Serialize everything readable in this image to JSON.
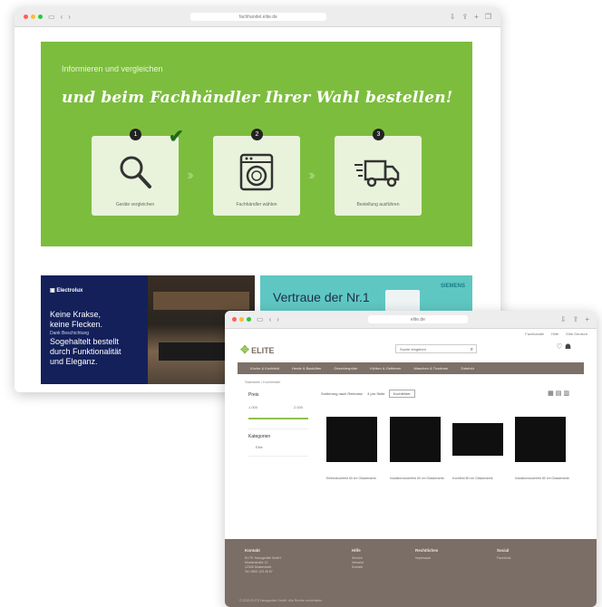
{
  "window1": {
    "url": "fachhandel.elite.de",
    "hero": {
      "subtitle": "Informieren und vergleichen",
      "title": "und beim Fachhändler Ihrer Wahl bestellen!",
      "steps": [
        {
          "number": "1",
          "label": "Geräte vergleichen",
          "icon": "magnifier-icon"
        },
        {
          "number": "2",
          "label": "Fachhändler wählen",
          "icon": "washing-machine-icon"
        },
        {
          "number": "3",
          "label": "Bestellung ausführen",
          "icon": "delivery-truck-icon"
        }
      ]
    },
    "banner_electrolux": {
      "brand": "Electrolux",
      "headline_1": "Keine Krakse,",
      "headline_2": "keine Flecken.",
      "small": "Dank Beschichtung",
      "headline_3": "Sogehaltelt bestellt",
      "headline_4": "durch Funktionalität",
      "headline_5": "und Eleganz."
    },
    "banner_siemens": {
      "headline": "Vertraue der Nr.1",
      "brand": "SIEMENS"
    }
  },
  "window2": {
    "url": "elite.de",
    "top_links": [
      "Fachhandel",
      "Hilfe",
      "Elite Deutsch"
    ],
    "logo": "ELITE",
    "search_placeholder": "Suche eingeben",
    "categories": [
      "Küche & Kochfeld",
      "Herde & Backöfen",
      "Geschirrspüler",
      "Kühlen & Gefrieren",
      "Waschen & Trocknen",
      "Zubehör"
    ],
    "breadcrumb": "Startseite / Kochfelder",
    "filter_price_title": "Preis",
    "price_min": "1.000",
    "price_max": "2.000",
    "filter_brand_title": "Kategorien",
    "filter_brand_value": "Elite",
    "toolbar": {
      "results": "Sortierung nach Relevanz",
      "per_page": "4 pro Seite",
      "select": "Kochfelder"
    },
    "products": [
      {
        "name": "Elektrokochfeld 60 cm Glaskeramik"
      },
      {
        "name": "Induktionskochfeld 60 cm Glaskeramik"
      },
      {
        "name": "Kochfeld 80 cm Glaskeramik"
      },
      {
        "name": "Induktionskochfeld 80 cm Glaskeramik"
      }
    ],
    "footer": {
      "contact": {
        "title": "Kontakt",
        "lines": [
          "ELITE Hausgeräte GmbH",
          "Musterstraße 12",
          "12345 Musterstadt",
          "Tel. 0800 123 45 67"
        ]
      },
      "help": {
        "title": "Hilfe",
        "lines": [
          "Service",
          "Versand",
          "Kontakt"
        ]
      },
      "legal": {
        "title": "Rechtliches",
        "lines": [
          "Impressum"
        ]
      },
      "social": {
        "title": "Social",
        "lines": [
          "Facebook"
        ]
      },
      "copyright": "© 2023 ELITE Hausgeräte GmbH. Alle Rechte vorbehalten."
    }
  },
  "colors": {
    "hero_green": "#7dbd3e",
    "footer_brown": "#7b6e66",
    "electrolux_navy": "#13205a",
    "siemens_teal": "#5fc7c2"
  }
}
